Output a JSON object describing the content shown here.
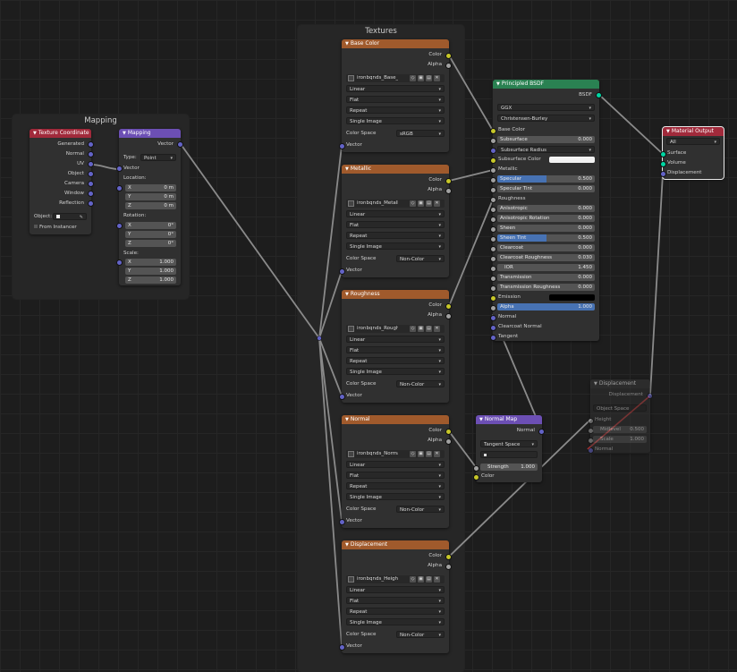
{
  "frames": {
    "mapping_title": "Mapping",
    "textures_title": "Textures"
  },
  "texture_coordinate": {
    "title": "Texture Coordinate",
    "outputs": [
      "Generated",
      "Normal",
      "UV",
      "Object",
      "Camera",
      "Window",
      "Reflection"
    ],
    "object_label": "Object:",
    "from_instancer": "From Instancer"
  },
  "mapping": {
    "title": "Mapping",
    "output": "Vector",
    "type_label": "Type:",
    "type_value": "Point",
    "input_vector": "Vector",
    "location_label": "Location:",
    "location": [
      {
        "axis": "X",
        "value": "0 m"
      },
      {
        "axis": "Y",
        "value": "0 m"
      },
      {
        "axis": "Z",
        "value": "0 m"
      }
    ],
    "rotation_label": "Rotation:",
    "rotation": [
      {
        "axis": "X",
        "value": "0°"
      },
      {
        "axis": "Y",
        "value": "0°"
      },
      {
        "axis": "Z",
        "value": "0°"
      }
    ],
    "scale_label": "Scale:",
    "scale": [
      {
        "axis": "X",
        "value": "1.000"
      },
      {
        "axis": "Y",
        "value": "1.000"
      },
      {
        "axis": "Z",
        "value": "1.000"
      }
    ]
  },
  "image_nodes": [
    {
      "title": "Base Color",
      "image": "ironbqnds_Base_...",
      "color_space": "sRGB"
    },
    {
      "title": "Metallic",
      "image": "ironbqnds_Metallic...",
      "color_space": "Non-Color"
    },
    {
      "title": "Roughness",
      "image": "ironbqnds_Roughn...",
      "color_space": "Non-Color"
    },
    {
      "title": "Normal",
      "image": "ironbqnds_Normal...",
      "color_space": "Non-Color"
    },
    {
      "title": "Displacement",
      "image": "ironbqnds_Height...",
      "color_space": "Non-Color"
    }
  ],
  "image_common": {
    "out_color": "Color",
    "out_alpha": "Alpha",
    "interpolation": "Linear",
    "projection": "Flat",
    "extension": "Repeat",
    "source": "Single Image",
    "color_space_label": "Color Space",
    "in_vector": "Vector"
  },
  "principled": {
    "title": "Principled BSDF",
    "output": "BSDF",
    "distribution": "GGX",
    "subsurface_method": "Christensen-Burley",
    "base_color": "Base Color",
    "subsurface": {
      "label": "Subsurface",
      "value": "0.000"
    },
    "subsurface_radius": "Subsurface Radius",
    "subsurface_color": "Subsurface Color",
    "metallic": "Metallic",
    "specular": {
      "label": "Specular",
      "value": "0.500",
      "fill": 0.5
    },
    "specular_tint": {
      "label": "Specular Tint",
      "value": "0.000"
    },
    "roughness": "Roughness",
    "anisotropic": {
      "label": "Anisotropic",
      "value": "0.000"
    },
    "anisotropic_rotation": {
      "label": "Anisotropic Rotation",
      "value": "0.000"
    },
    "sheen": {
      "label": "Sheen",
      "value": "0.000"
    },
    "sheen_tint": {
      "label": "Sheen Tint",
      "value": "0.500",
      "fill": 0.5
    },
    "clearcoat": {
      "label": "Clearcoat",
      "value": "0.000"
    },
    "clearcoat_roughness": {
      "label": "Clearcoat Roughness",
      "value": "0.030"
    },
    "ior": {
      "label": "IOR",
      "value": "1.450"
    },
    "transmission": {
      "label": "Transmission",
      "value": "0.000"
    },
    "transmission_roughness": {
      "label": "Transmission Roughness",
      "value": "0.000"
    },
    "emission": "Emission",
    "alpha": {
      "label": "Alpha",
      "value": "1.000",
      "fill": 1.0
    },
    "normal": "Normal",
    "clearcoat_normal": "Clearcoat Normal",
    "tangent": "Tangent"
  },
  "material_output": {
    "title": "Material Output",
    "target": "All",
    "surface": "Surface",
    "volume": "Volume",
    "displacement": "Displacement"
  },
  "normal_map": {
    "title": "Normal Map",
    "output": "Normal",
    "space": "Tangent Space",
    "uv_map": "",
    "strength": {
      "label": "Strength",
      "value": "1.000"
    },
    "color": "Color"
  },
  "displacement_node": {
    "title": "Displacement",
    "output": "Displacement",
    "space": "Object Space",
    "height": "Height",
    "midlevel": {
      "label": "Midlevel",
      "value": "0.500"
    },
    "scale": {
      "label": "Scale",
      "value": "1.000"
    },
    "normal": "Normal"
  },
  "colors": {
    "texture_header": "#a05a2c",
    "input_header": "#a12a3b",
    "vector_header": "#6c4fb4",
    "shader_header": "#2a8152",
    "output_header": "#a12a3b",
    "displacement_header": "#3a3a3a",
    "wire": "#8a8a8a",
    "wire_muted": "#d03a3a"
  }
}
